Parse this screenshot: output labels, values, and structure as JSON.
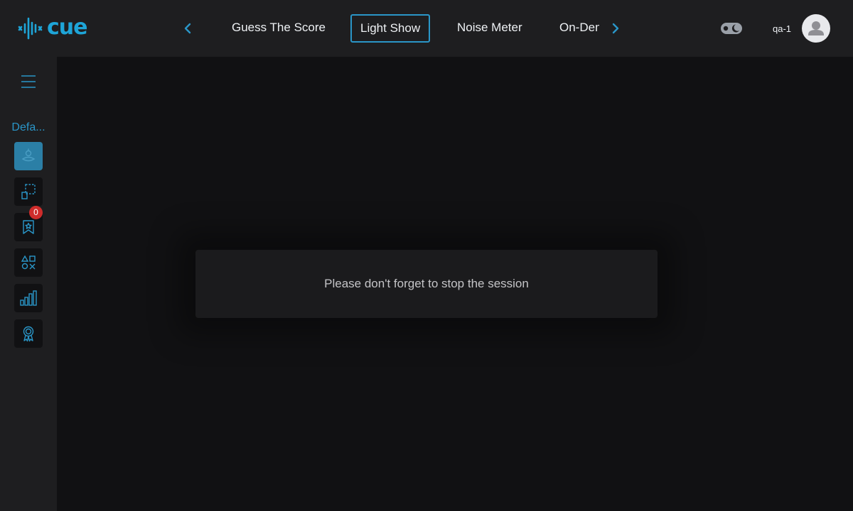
{
  "app": {
    "logo_text": "cue"
  },
  "header": {
    "tabs": [
      {
        "label": "Guess The Score",
        "active": false
      },
      {
        "label": "Light Show",
        "active": true
      },
      {
        "label": "Noise Meter",
        "active": false
      },
      {
        "label": "On-Demand",
        "active": false
      }
    ],
    "username": "qa-1"
  },
  "sidebar": {
    "group_label": "Defa...",
    "items": [
      {
        "icon": "person-icon",
        "active": true
      },
      {
        "icon": "dashed-square-icon",
        "active": false
      },
      {
        "icon": "bookmark-star-icon",
        "active": false,
        "badge": "0"
      },
      {
        "icon": "shapes-icon",
        "active": false
      },
      {
        "icon": "bar-chart-icon",
        "active": false
      },
      {
        "icon": "award-icon",
        "active": false
      }
    ]
  },
  "dialog": {
    "message": "Please don't forget to stop the session"
  },
  "colors": {
    "accent": "#1ea5d8",
    "badge": "#cf2c2b",
    "background": "#111113",
    "panel": "#1e1e20"
  }
}
